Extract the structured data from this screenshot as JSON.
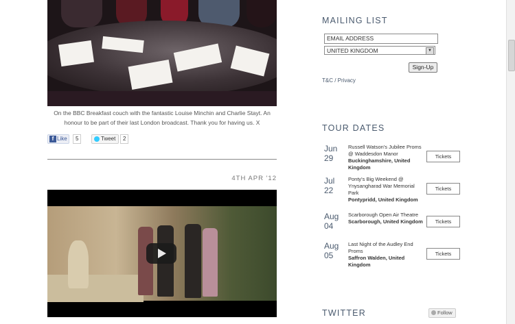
{
  "post1": {
    "caption": "On the BBC Breakfast couch with the fantastic Louise Minchin and Charlie Stayt. An honour to be part of their last London broadcast. Thank you for having us. X",
    "like_label": "Like",
    "like_count": "5",
    "tweet_label": "Tweet",
    "tweet_count": "2"
  },
  "post2": {
    "date": "4TH APR '12"
  },
  "mailing": {
    "heading": "MAILING LIST",
    "email_placeholder": "EMAIL ADDRESS",
    "country_selected": "UNITED KINGDOM",
    "signup_label": "Sign-Up",
    "tc_label": "T&C / Privacy"
  },
  "tour": {
    "heading": "TOUR DATES",
    "tickets_label": "Tickets",
    "dates": [
      {
        "month": "Jun",
        "day": "29",
        "event": "Russell Watson's Jubilee Proms @ Waddesdon Manor",
        "location": "Buckinghamshire, United Kingdom"
      },
      {
        "month": "Jul",
        "day": "22",
        "event": "Ponty's Big Weekend @ Ynysangharad War Memorial Park",
        "location": "Pontypridd, United Kingdom"
      },
      {
        "month": "Aug",
        "day": "04",
        "event": "Scarborough Open Air Theatre",
        "location": "Scarborough, United Kingdom"
      },
      {
        "month": "Aug",
        "day": "05",
        "event": "Last Night of the Audley End Proms",
        "location": "Saffron Walden, United Kingdom"
      }
    ]
  },
  "twitter": {
    "heading": "TWITTER",
    "follow_label": "Follow"
  }
}
